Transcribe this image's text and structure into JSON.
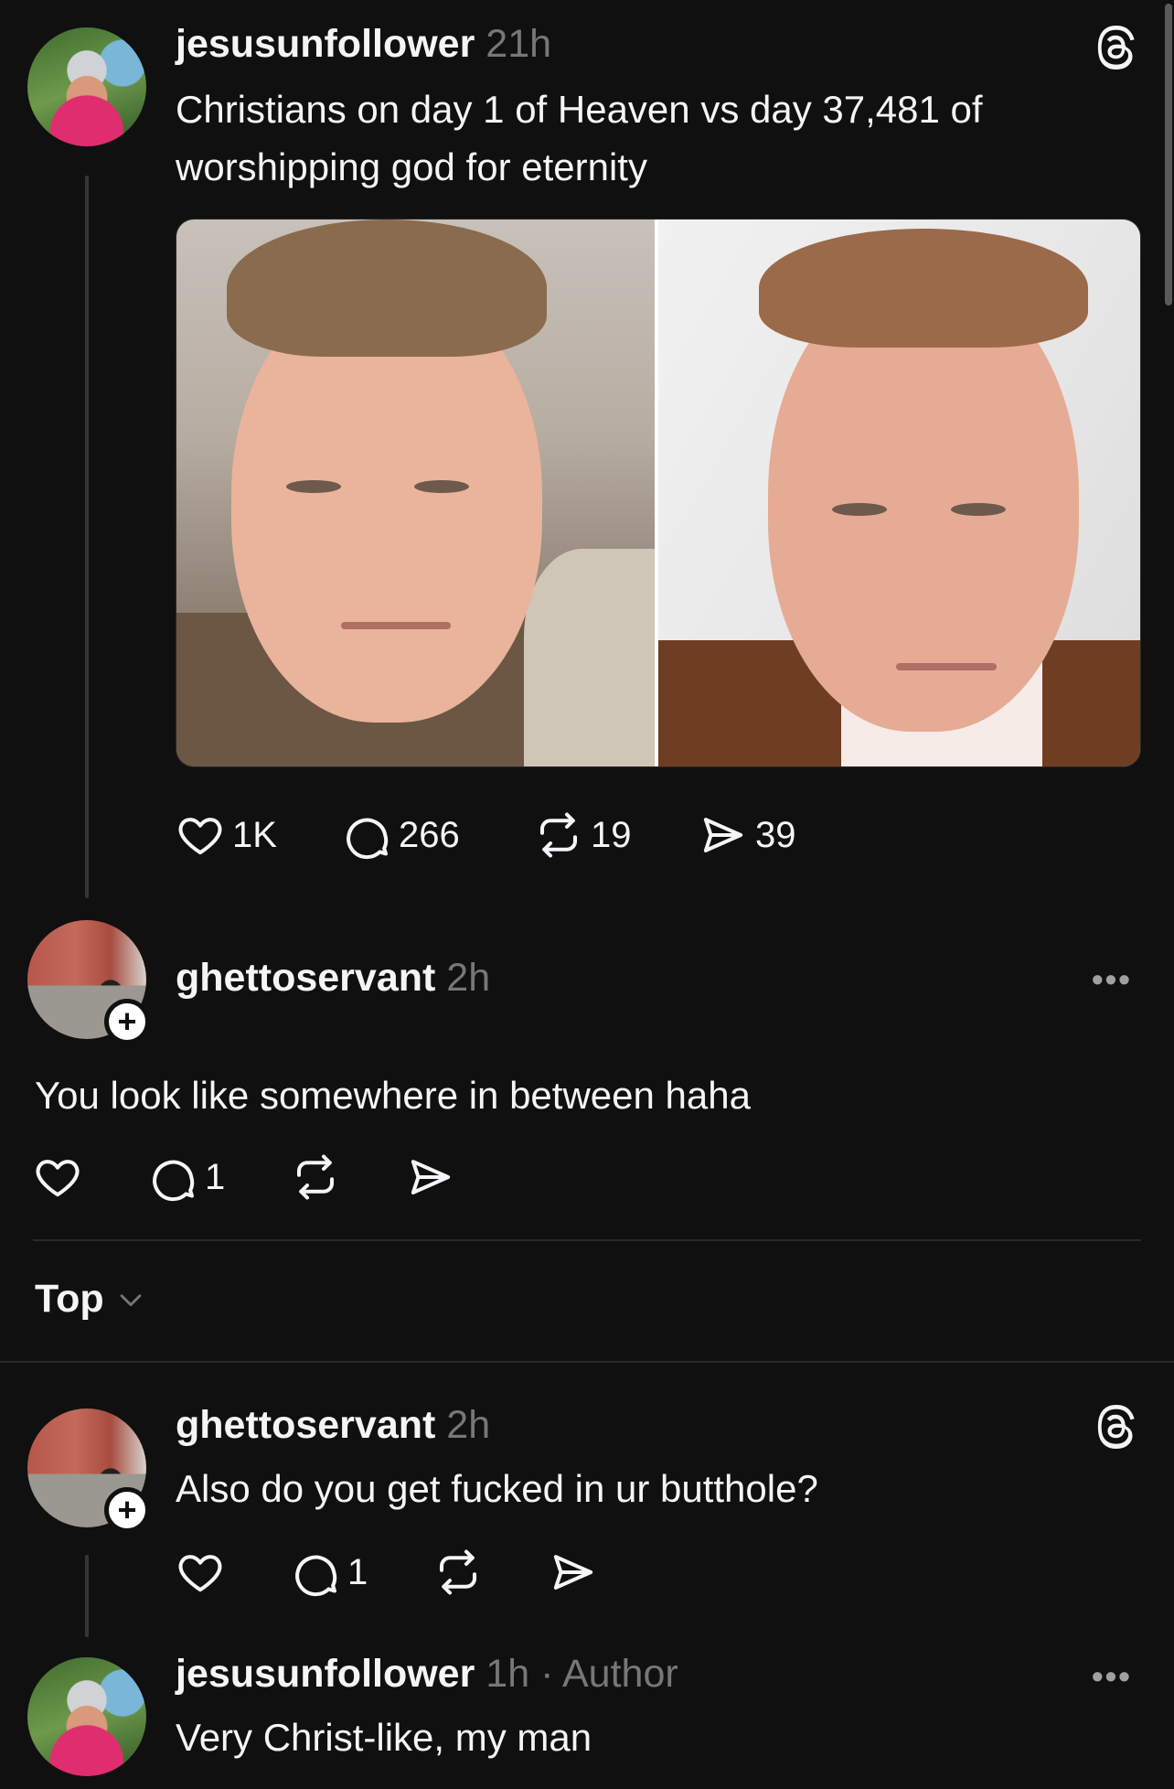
{
  "post": {
    "username": "jesusunfollower",
    "time": "21h",
    "text_line1": "Christians on day 1 of Heaven vs day 37,481 of",
    "text_line2": "worshipping god for eternity",
    "stats": {
      "likes": "1K",
      "replies": "266",
      "reposts": "19",
      "shares": "39"
    }
  },
  "reply1": {
    "username": "ghettoservant",
    "time": "2h",
    "text": "You look like somewhere in between haha",
    "stats": {
      "replies": "1"
    }
  },
  "sort": {
    "label": "Top"
  },
  "comment1": {
    "username": "ghettoservant",
    "time": "2h",
    "text": "Also do you get fucked in ur butthole?",
    "stats": {
      "replies": "1"
    }
  },
  "comment2": {
    "username": "jesusunfollower",
    "time": "1h",
    "separator": "·",
    "author_badge": "Author",
    "text": "Very Christ-like, my man"
  },
  "icons": {
    "like": "heart-icon",
    "reply": "comment-icon",
    "repost": "repost-icon",
    "share": "send-icon",
    "brand": "threads-logo-icon",
    "more": "more-icon"
  },
  "colors": {
    "background": "#101010",
    "text": "#f3f5f7",
    "secondary": "#777777"
  }
}
